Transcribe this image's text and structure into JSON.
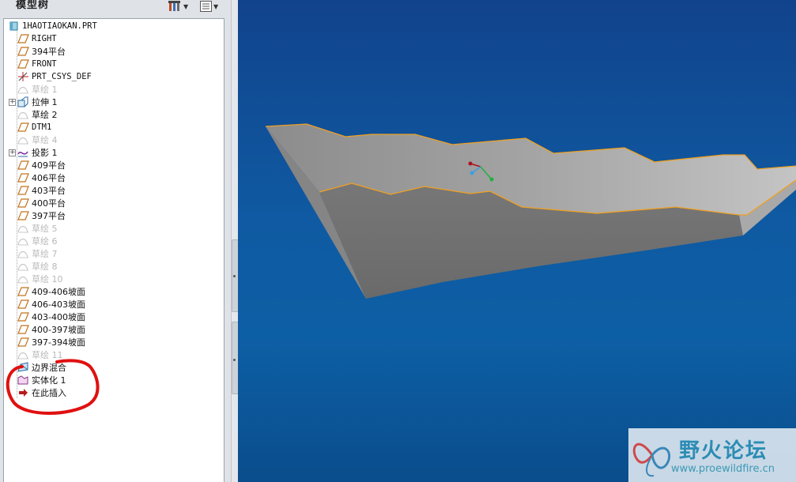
{
  "model_tree": {
    "title": "模型树",
    "toolbar": {
      "settings_icon": "filter-tools-icon",
      "view_icon": "tree-columns-icon"
    },
    "items": [
      {
        "label": "1HAOTIAOKAN.PRT",
        "icon": "part-icon",
        "state": "active",
        "expandable": false
      },
      {
        "label": "RIGHT",
        "icon": "datum-plane-icon",
        "state": "active",
        "expandable": false
      },
      {
        "label": "394平台",
        "icon": "datum-plane-icon",
        "state": "active",
        "expandable": false
      },
      {
        "label": "FRONT",
        "icon": "datum-plane-icon",
        "state": "active",
        "expandable": false
      },
      {
        "label": "PRT_CSYS_DEF",
        "icon": "csys-icon",
        "state": "active",
        "expandable": false
      },
      {
        "label": "草绘 1",
        "icon": "sketch-icon",
        "state": "hidden",
        "expandable": false
      },
      {
        "label": "拉伸 1",
        "icon": "extrude-icon",
        "state": "active",
        "expandable": true
      },
      {
        "label": "草绘 2",
        "icon": "sketch-icon",
        "state": "active",
        "expandable": false
      },
      {
        "label": "DTM1",
        "icon": "datum-plane-icon",
        "state": "active",
        "expandable": false
      },
      {
        "label": "草绘 4",
        "icon": "sketch-icon",
        "state": "hidden",
        "expandable": false
      },
      {
        "label": "投影 1",
        "icon": "projection-icon",
        "state": "active",
        "expandable": true
      },
      {
        "label": "409平台",
        "icon": "datum-plane-icon",
        "state": "active",
        "expandable": false
      },
      {
        "label": "406平台",
        "icon": "datum-plane-icon",
        "state": "active",
        "expandable": false
      },
      {
        "label": "403平台",
        "icon": "datum-plane-icon",
        "state": "active",
        "expandable": false
      },
      {
        "label": "400平台",
        "icon": "datum-plane-icon",
        "state": "active",
        "expandable": false
      },
      {
        "label": "397平台",
        "icon": "datum-plane-icon",
        "state": "active",
        "expandable": false
      },
      {
        "label": "草绘 5",
        "icon": "sketch-icon",
        "state": "hidden",
        "expandable": false
      },
      {
        "label": "草绘 6",
        "icon": "sketch-icon",
        "state": "hidden",
        "expandable": false
      },
      {
        "label": "草绘 7",
        "icon": "sketch-icon",
        "state": "hidden",
        "expandable": false
      },
      {
        "label": "草绘 8",
        "icon": "sketch-icon",
        "state": "hidden",
        "expandable": false
      },
      {
        "label": "草绘 10",
        "icon": "sketch-icon",
        "state": "hidden",
        "expandable": false
      },
      {
        "label": "409-406坡面",
        "icon": "datum-plane-icon",
        "state": "active",
        "expandable": false
      },
      {
        "label": "406-403坡面",
        "icon": "datum-plane-icon",
        "state": "active",
        "expandable": false
      },
      {
        "label": "403-400坡面",
        "icon": "datum-plane-icon",
        "state": "active",
        "expandable": false
      },
      {
        "label": "400-397坡面",
        "icon": "datum-plane-icon",
        "state": "active",
        "expandable": false
      },
      {
        "label": "397-394坡面",
        "icon": "datum-plane-icon",
        "state": "active",
        "expandable": false
      },
      {
        "label": "草绘 11",
        "icon": "sketch-icon",
        "state": "hidden",
        "expandable": false
      },
      {
        "label": "边界混合",
        "icon": "boundary-blend-icon",
        "state": "active",
        "expandable": false
      },
      {
        "label": "实体化 1",
        "icon": "solidify-icon",
        "state": "active",
        "expandable": false
      },
      {
        "label": "在此插入",
        "icon": "insert-here-arrow-icon",
        "state": "active",
        "expandable": false
      }
    ]
  },
  "colors": {
    "annotation_circle": "#e01010",
    "edge_highlight": "#f0a020",
    "viewport_bg": "#0f5aa2"
  },
  "viewport": {
    "model_description": "gray stepped 3D solid"
  },
  "watermark": {
    "title": "野火论坛",
    "url": "www.proewildfire.cn"
  }
}
